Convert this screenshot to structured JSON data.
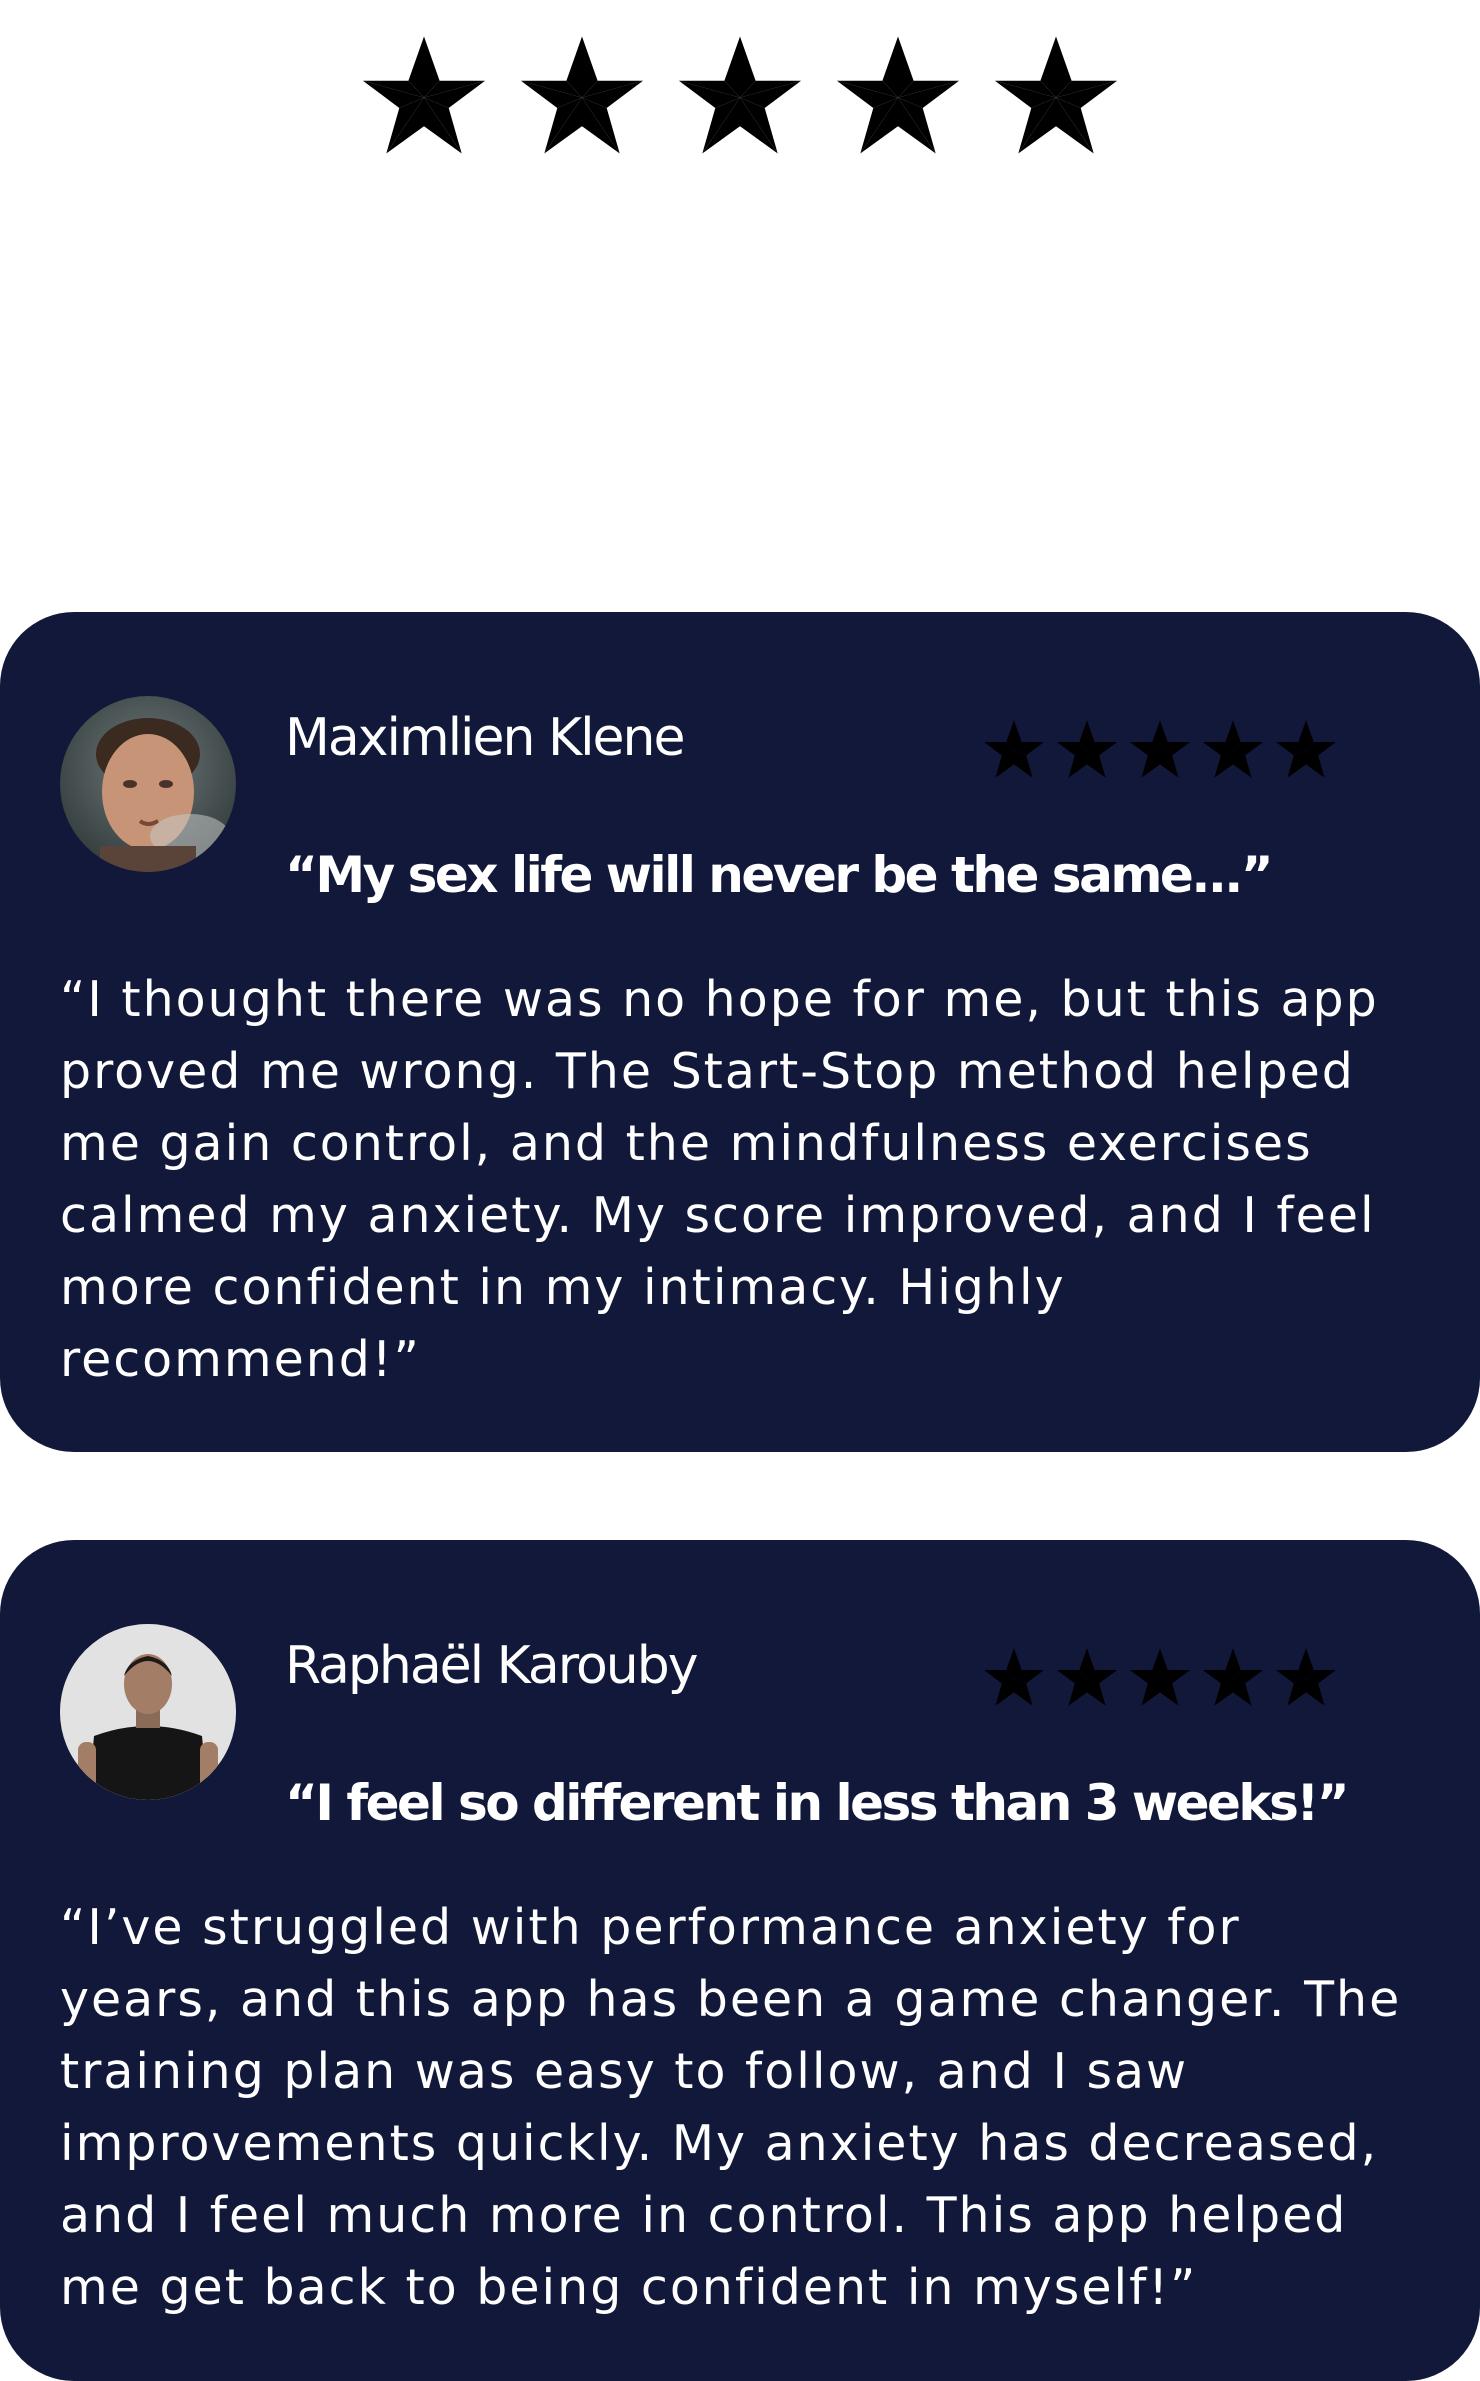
{
  "top_rating": {
    "stars": 5,
    "max_stars": 5,
    "icon": "star-icon",
    "color": "#f3be1c"
  },
  "reviews": [
    {
      "name": "Maximlien Klene",
      "avatar_icon": "avatar-photo",
      "rating": 5,
      "max_rating": 5,
      "headline": "“My sex life will never be the same...”",
      "body_lines": [
        "“I thought there was no hope for me, but this app",
        "proved me wrong. The Start-Stop method helped",
        "me gain control, and the mindfulness exercises",
        "calmed my anxiety. My score improved, and I feel",
        "more confident in my intimacy. Highly",
        "recommend!”"
      ]
    },
    {
      "name": "Raphaël Karouby",
      "avatar_icon": "avatar-photo",
      "rating": 5,
      "max_rating": 5,
      "headline": "“I feel so different in less than 3 weeks!”",
      "body_lines": [
        "“I’ve struggled with performance anxiety for",
        "years, and this app has been a game changer. The",
        "training plan was easy to follow, and I saw",
        "improvements quickly. My anxiety has decreased,",
        "and I feel much more in control. This app helped",
        "me get back to being confident in myself!”"
      ]
    }
  ],
  "colors": {
    "card_background": "#12183a",
    "card_text": "#ffffff",
    "page_background": "#ffffff",
    "star_gold": "#f3be1c"
  }
}
